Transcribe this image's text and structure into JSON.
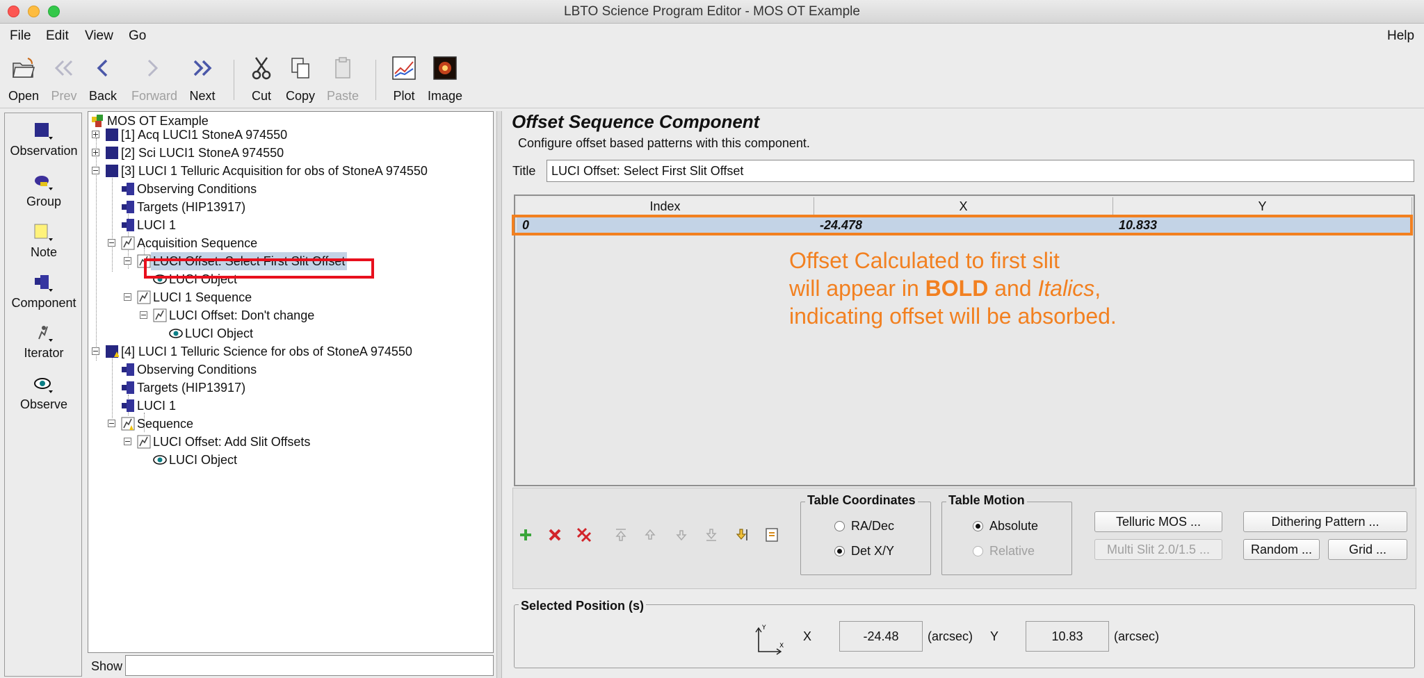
{
  "window": {
    "title": "LBTO Science Program Editor - MOS OT Example"
  },
  "menu": {
    "file": "File",
    "edit": "Edit",
    "view": "View",
    "go": "Go",
    "help": "Help"
  },
  "toolbar": {
    "open": "Open",
    "prev": "Prev",
    "back": "Back",
    "forward": "Forward",
    "next": "Next",
    "cut": "Cut",
    "copy": "Copy",
    "paste": "Paste",
    "plot": "Plot",
    "image": "Image"
  },
  "palette": {
    "observation": "Observation",
    "group": "Group",
    "note": "Note",
    "component": "Component",
    "iterator": "Iterator",
    "observe": "Observe"
  },
  "tree": {
    "root": "MOS OT Example",
    "obs1": "[1] Acq LUCI1 StoneA 974550",
    "obs2": "[2] Sci LUCI1 StoneA 974550",
    "obs3": "[3] LUCI 1 Telluric Acquisition for obs of StoneA 974550",
    "obs3_conditions": "Observing Conditions",
    "obs3_targets": "Targets (HIP13917)",
    "obs3_luci": "LUCI 1",
    "obs3_acq_seq": "Acquisition Sequence",
    "obs3_offset_select": "LUCI Offset: Select First Slit Offset",
    "obs3_object1": "LUCI Object",
    "obs3_luci_seq": "LUCI 1 Sequence",
    "obs3_offset_dont": "LUCI Offset: Don't change",
    "obs3_object2": "LUCI Object",
    "obs4": "[4] LUCI 1 Telluric Science for obs of StoneA 974550",
    "obs4_conditions": "Observing Conditions",
    "obs4_targets": "Targets (HIP13917)",
    "obs4_luci": "LUCI 1",
    "obs4_seq": "Sequence",
    "obs4_offset_add": "LUCI Offset: Add Slit Offsets",
    "obs4_object": "LUCI Object"
  },
  "show": {
    "label": "Show",
    "value": ""
  },
  "editor": {
    "heading": "Offset Sequence Component",
    "description": "Configure offset based patterns with this component.",
    "title_label": "Title",
    "title_value": "LUCI Offset: Select First Slit Offset"
  },
  "table": {
    "columns": [
      "Index",
      "X",
      "Y"
    ],
    "rows": [
      {
        "index": "0",
        "x": "-24.478",
        "y": "10.833"
      }
    ]
  },
  "annotation": {
    "line1": "Offset Calculated to first slit",
    "line2_pre": "will appear in ",
    "line2_bold": "BOLD",
    "line2_mid": " and ",
    "line2_italic": "Italics",
    "line2_post": ",",
    "line3": "indicating offset will be absorbed.",
    "color": "#f28020"
  },
  "coordinates": {
    "title": "Table Coordinates",
    "ra_dec": "RA/Dec",
    "det_xy": "Det X/Y",
    "selected": "Det X/Y"
  },
  "motion": {
    "title": "Table Motion",
    "absolute": "Absolute",
    "relative": "Relative",
    "selected": "Absolute"
  },
  "buttons": {
    "telluric_mos": "Telluric MOS ...",
    "multi_slit": "Multi Slit 2.0/1.5 ...",
    "dithering": "Dithering Pattern ...",
    "random": "Random ...",
    "grid": "Grid ..."
  },
  "selected_position": {
    "title": "Selected Position (s)",
    "x_label": "X",
    "x_value": "-24.48",
    "x_unit": "(arcsec)",
    "y_label": "Y",
    "y_value": "10.83",
    "y_unit": "(arcsec)"
  },
  "icons": {
    "open": "folder-open-icon",
    "prev": "double-chevron-left-icon",
    "back": "chevron-left-icon",
    "forward": "chevron-right-icon",
    "next": "double-chevron-right-icon",
    "cut": "scissors-icon",
    "copy": "copy-icon",
    "paste": "clipboard-icon",
    "plot": "plot-icon",
    "image": "image-icon",
    "add_row": "plus-icon",
    "remove_row": "x-icon",
    "remove_all": "double-x-icon"
  },
  "colors": {
    "selection": "#c3d3e6",
    "highlight_red": "#e8101d",
    "highlight_orange": "#f28020"
  }
}
